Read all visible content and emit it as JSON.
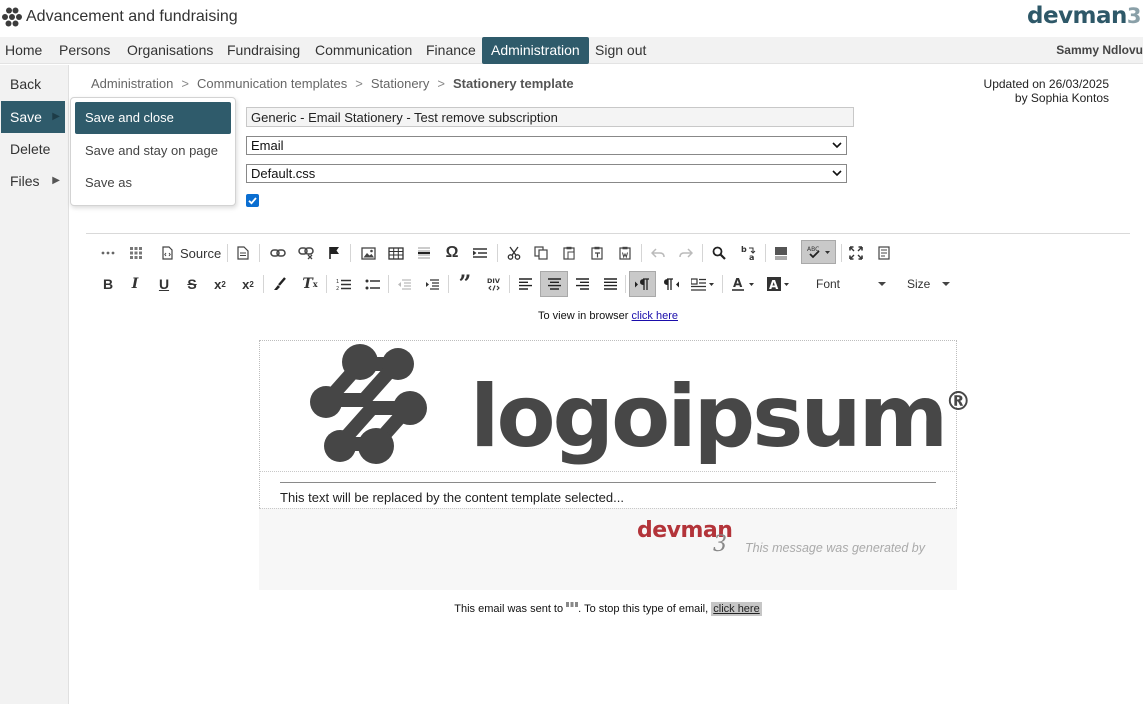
{
  "app": {
    "title": "Advancement and fundraising",
    "brand": "devman",
    "brand_num": "3"
  },
  "nav": {
    "items": [
      {
        "label": "Home"
      },
      {
        "label": "Persons"
      },
      {
        "label": "Organisations"
      },
      {
        "label": "Fundraising"
      },
      {
        "label": "Communication"
      },
      {
        "label": "Finance"
      },
      {
        "label": "Administration",
        "active": true
      },
      {
        "label": "Sign out"
      }
    ],
    "user": "Sammy Ndlovu"
  },
  "sidebar": {
    "items": [
      {
        "label": "Back"
      },
      {
        "label": "Save",
        "active": true,
        "has_submenu": true
      },
      {
        "label": "Delete"
      },
      {
        "label": "Files",
        "has_submenu": true
      }
    ]
  },
  "save_menu": {
    "items": [
      {
        "label": "Save and close",
        "active": true
      },
      {
        "label": "Save and stay on page"
      },
      {
        "label": "Save as"
      }
    ]
  },
  "breadcrumb": {
    "items": [
      "Administration",
      "Communication templates",
      "Stationery"
    ],
    "current": "Stationery template",
    "separator": ">"
  },
  "updated": {
    "line1": "Updated on 26/03/2025",
    "line2": "by Sophia Kontos"
  },
  "form": {
    "name_value": "Generic - Email Stationery - Test remove subscription",
    "type_selected": "Email",
    "css_selected": "Default.css",
    "active_checked": true
  },
  "toolbar": {
    "source_label": "Source",
    "font_label": "Font",
    "size_label": "Size",
    "row1_icons": [
      "show-blocks-icon",
      "templates-icon",
      "source-icon",
      "new-page-icon",
      "link-icon",
      "unlink-icon",
      "anchor-icon",
      "image-icon",
      "table-icon",
      "horizontal-line-icon",
      "special-char-icon",
      "insert-iframe-icon",
      "cut-icon",
      "copy-icon",
      "paste-icon",
      "paste-text-icon",
      "paste-word-icon",
      "undo-icon",
      "redo-icon",
      "find-icon",
      "replace-icon",
      "select-all-icon",
      "spellcheck-icon",
      "maximize-icon",
      "preview-icon"
    ],
    "row2_icons": [
      "bold-icon",
      "italic-icon",
      "underline-icon",
      "strikethrough-icon",
      "subscript-icon",
      "superscript-icon",
      "copy-format-icon",
      "remove-format-icon",
      "numbered-list-icon",
      "bulleted-list-icon",
      "outdent-icon",
      "indent-icon",
      "blockquote-icon",
      "create-div-icon",
      "align-left-icon",
      "align-center-icon",
      "align-right-icon",
      "justify-icon",
      "ltr-icon",
      "rtl-icon",
      "styles-icon",
      "text-color-icon",
      "bg-color-icon"
    ]
  },
  "editor": {
    "view_prefix": "To view in browser ",
    "view_link": "click here",
    "logo_text": "logoipsum",
    "logo_mark": "®",
    "content_placeholder": "This text will be replaced by the content template selected...",
    "footer_brand": "devman",
    "footer_brand_num": "3",
    "generated_msg": "This message was generated by",
    "sent_prefix": "This email was sent to ",
    "sent_mid": ". To stop this type of email, ",
    "sent_link": "click here"
  },
  "colors": {
    "accent": "#2f5b6b",
    "brand_red": "#b3343a",
    "link": "#1a0dab"
  }
}
